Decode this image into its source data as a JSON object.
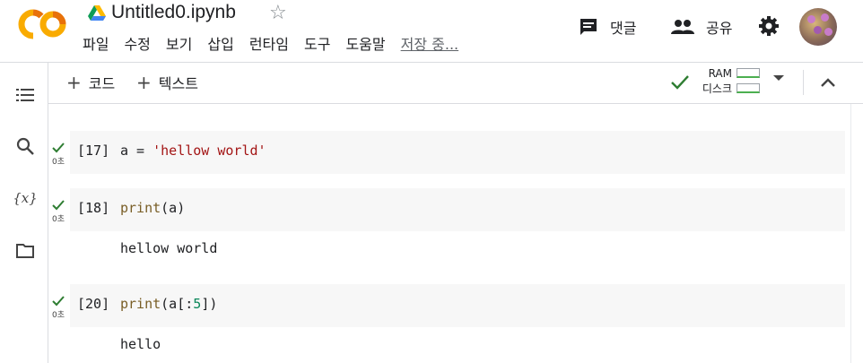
{
  "header": {
    "title": "Untitled0.ipynb",
    "menu": [
      "파일",
      "수정",
      "보기",
      "삽입",
      "런타임",
      "도구",
      "도움말"
    ],
    "saving_status": "저장 중...",
    "comment_label": "댓글",
    "share_label": "공유",
    "logo_icon": "colab-logo",
    "brand_colors": {
      "orange": "#f9ab00",
      "dark_orange": "#e8710a"
    }
  },
  "toolbar": {
    "add_code_label": "코드",
    "add_text_label": "텍스트",
    "ram_label": "RAM",
    "disk_label": "디스크"
  },
  "cells": [
    {
      "exec_count": "[17]",
      "time": "0초",
      "code_tokens": [
        {
          "text": "a = ",
          "kind": "plain"
        },
        {
          "text": "'hellow world'",
          "kind": "str"
        }
      ],
      "output": ""
    },
    {
      "exec_count": "[18]",
      "time": "0초",
      "code_tokens": [
        {
          "text": "print",
          "kind": "fn"
        },
        {
          "text": "(a)",
          "kind": "plain"
        }
      ],
      "output": "hellow world"
    },
    {
      "exec_count": "[20]",
      "time": "0초",
      "code_tokens": [
        {
          "text": "print",
          "kind": "fn"
        },
        {
          "text": "(a[:",
          "kind": "plain"
        },
        {
          "text": "5",
          "kind": "num"
        },
        {
          "text": "])",
          "kind": "plain"
        }
      ],
      "output": "hello"
    }
  ]
}
